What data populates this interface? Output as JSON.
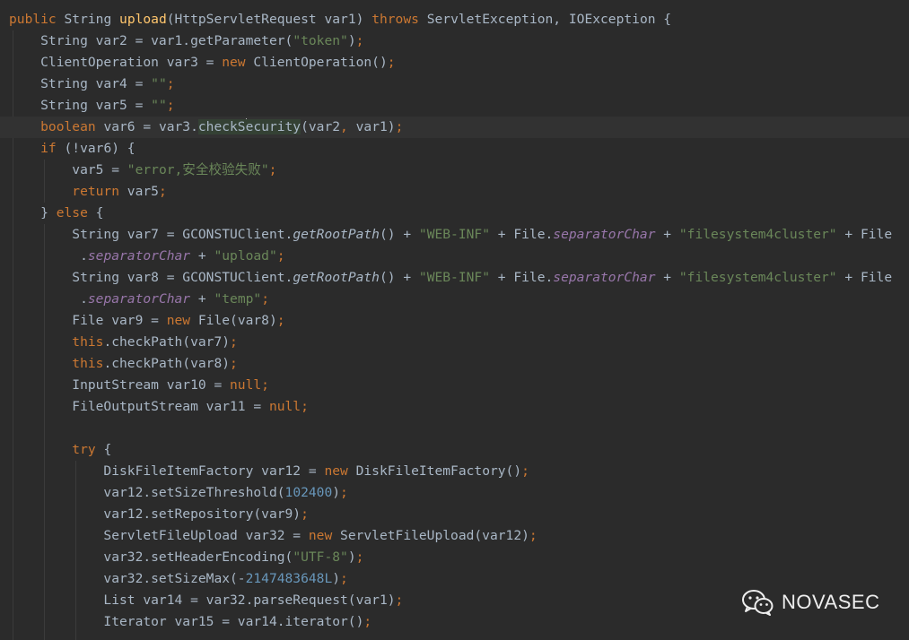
{
  "code": {
    "language": "java",
    "current_line": 6,
    "lines": [
      [
        [
          "kw",
          "public "
        ],
        [
          "",
          "String "
        ],
        [
          "fn",
          "upload"
        ],
        [
          "",
          "(HttpServletRequest var1) "
        ],
        [
          "kw",
          "throws "
        ],
        [
          "",
          "ServletException, IOException {"
        ]
      ],
      [
        [
          "",
          "    String var2 = var1.getParameter("
        ],
        [
          "str",
          "\"token\""
        ],
        [
          "",
          ")"
        ],
        [
          "kw",
          ";"
        ]
      ],
      [
        [
          "",
          "    ClientOperation var3 = "
        ],
        [
          "kw",
          "new "
        ],
        [
          "",
          "ClientOperation()"
        ],
        [
          "kw",
          ";"
        ]
      ],
      [
        [
          "",
          "    String var4 = "
        ],
        [
          "str",
          "\"\""
        ],
        [
          "kw",
          ";"
        ]
      ],
      [
        [
          "",
          "    String var5 = "
        ],
        [
          "str",
          "\"\""
        ],
        [
          "kw",
          ";"
        ]
      ],
      [
        [
          "kw",
          "    boolean "
        ],
        [
          "",
          "var6 = var3."
        ],
        [
          "hl",
          "checkS"
        ],
        [
          "caret",
          ""
        ],
        [
          "hl",
          "ecurity"
        ],
        [
          "",
          "(var2"
        ],
        [
          "kw",
          ", "
        ],
        [
          "",
          "var1)"
        ],
        [
          "kw",
          ";"
        ]
      ],
      [
        [
          "kw",
          "    if "
        ],
        [
          "",
          "(!var6) {"
        ]
      ],
      [
        [
          "",
          "        var5 = "
        ],
        [
          "str",
          "\"error,安全校验失败\""
        ],
        [
          "kw",
          ";"
        ]
      ],
      [
        [
          "kw",
          "        return "
        ],
        [
          "",
          "var5"
        ],
        [
          "kw",
          ";"
        ]
      ],
      [
        [
          "",
          "    } "
        ],
        [
          "kw",
          "else "
        ],
        [
          "",
          "{"
        ]
      ],
      [
        [
          "",
          "        String var7 = GCONSTUClient."
        ],
        [
          "st",
          "getRootPath"
        ],
        [
          "",
          "() + "
        ],
        [
          "str",
          "\"WEB-INF\""
        ],
        [
          "",
          " + File."
        ],
        [
          "fld",
          "separatorChar"
        ],
        [
          "",
          " + "
        ],
        [
          "str",
          "\"filesystem4cluster\""
        ],
        [
          "",
          " + File"
        ]
      ],
      [
        [
          "",
          "         ."
        ],
        [
          "fld",
          "separatorChar"
        ],
        [
          "",
          " + "
        ],
        [
          "str",
          "\"upload\""
        ],
        [
          "kw",
          ";"
        ]
      ],
      [
        [
          "",
          "        String var8 = GCONSTUClient."
        ],
        [
          "st",
          "getRootPath"
        ],
        [
          "",
          "() + "
        ],
        [
          "str",
          "\"WEB-INF\""
        ],
        [
          "",
          " + File."
        ],
        [
          "fld",
          "separatorChar"
        ],
        [
          "",
          " + "
        ],
        [
          "str",
          "\"filesystem4cluster\""
        ],
        [
          "",
          " + File"
        ]
      ],
      [
        [
          "",
          "         ."
        ],
        [
          "fld",
          "separatorChar"
        ],
        [
          "",
          " + "
        ],
        [
          "str",
          "\"temp\""
        ],
        [
          "kw",
          ";"
        ]
      ],
      [
        [
          "",
          "        File var9 = "
        ],
        [
          "kw",
          "new "
        ],
        [
          "",
          "File(var8)"
        ],
        [
          "kw",
          ";"
        ]
      ],
      [
        [
          "kw",
          "        this"
        ],
        [
          "",
          ".checkPath(var7)"
        ],
        [
          "kw",
          ";"
        ]
      ],
      [
        [
          "kw",
          "        this"
        ],
        [
          "",
          ".checkPath(var8)"
        ],
        [
          "kw",
          ";"
        ]
      ],
      [
        [
          "",
          "        InputStream var10 = "
        ],
        [
          "kw",
          "null;"
        ]
      ],
      [
        [
          "",
          "        FileOutputStream var11 = "
        ],
        [
          "kw",
          "null;"
        ]
      ],
      [],
      [
        [
          "kw",
          "        try "
        ],
        [
          "",
          "{"
        ]
      ],
      [
        [
          "",
          "            DiskFileItemFactory var12 = "
        ],
        [
          "kw",
          "new "
        ],
        [
          "",
          "DiskFileItemFactory()"
        ],
        [
          "kw",
          ";"
        ]
      ],
      [
        [
          "",
          "            var12.setSizeThreshold("
        ],
        [
          "num",
          "102400"
        ],
        [
          "",
          ")"
        ],
        [
          "kw",
          ";"
        ]
      ],
      [
        [
          "",
          "            var12.setRepository(var9)"
        ],
        [
          "kw",
          ";"
        ]
      ],
      [
        [
          "",
          "            ServletFileUpload var32 = "
        ],
        [
          "kw",
          "new "
        ],
        [
          "",
          "ServletFileUpload(var12)"
        ],
        [
          "kw",
          ";"
        ]
      ],
      [
        [
          "",
          "            var32.setHeaderEncoding("
        ],
        [
          "str",
          "\"UTF-8\""
        ],
        [
          "",
          ")"
        ],
        [
          "kw",
          ";"
        ]
      ],
      [
        [
          "",
          "            var32.setSizeMax(-"
        ],
        [
          "num",
          "2147483648L"
        ],
        [
          "",
          ")"
        ],
        [
          "kw",
          ";"
        ]
      ],
      [
        [
          "",
          "            List var14 = var32.parseRequest(var1)"
        ],
        [
          "kw",
          ";"
        ]
      ],
      [
        [
          "",
          "            Iterator var15 = var14.iterator()"
        ],
        [
          "kw",
          ";"
        ]
      ]
    ]
  },
  "watermark": {
    "icon": "wechat-icon",
    "text": "NOVASEC"
  },
  "colors": {
    "background": "#2b2b2b",
    "default_text": "#a9b7c6",
    "keyword": "#cc7832",
    "method_declaration": "#ffc66d",
    "string": "#6a8759",
    "number": "#6897bb",
    "static_field": "#9876aa",
    "current_line": "#323232",
    "usage_highlight": "#344134"
  }
}
